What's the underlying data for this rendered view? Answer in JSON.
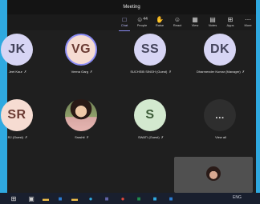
{
  "window": {
    "title": "Meeting"
  },
  "toolbar": {
    "items": [
      {
        "label": "Chat",
        "icon": "chat-icon",
        "active": true
      },
      {
        "label": "People",
        "icon": "people-icon",
        "count": "44"
      },
      {
        "label": "Raise",
        "icon": "raise-hand-icon"
      },
      {
        "label": "React",
        "icon": "react-icon"
      },
      {
        "label": "View",
        "icon": "view-icon"
      },
      {
        "label": "Notes",
        "icon": "notes-icon"
      },
      {
        "label": "Apps",
        "icon": "apps-icon"
      },
      {
        "label": "More",
        "icon": "more-icon"
      }
    ]
  },
  "participants": [
    {
      "initials": "JK",
      "name": "Jeet Kaur",
      "style": "purple"
    },
    {
      "initials": "VG",
      "name": "Veena Garg",
      "style": "peach"
    },
    {
      "initials": "SS",
      "name": "SUCHSIB SINGH (Guest)",
      "style": "purple"
    },
    {
      "initials": "DK",
      "name": "Dharmender Kumar (Manager)",
      "style": "purple"
    },
    {
      "initials": "SR",
      "name": "RJ (Guest)",
      "style": "peach"
    },
    {
      "initials": "",
      "name": "Srashti",
      "style": "photo"
    },
    {
      "initials": "S",
      "name": "SWATI (Guest)",
      "style": "green"
    },
    {
      "initials": "...",
      "name": "View all",
      "style": "dark"
    }
  ],
  "taskbar": {
    "apps": [
      {
        "icon": "windows-start-icon",
        "glyph": "⊞",
        "color": "#e6e6e6"
      },
      {
        "icon": "task-view-icon",
        "glyph": "▣",
        "color": "#d0d0d0"
      },
      {
        "icon": "file-explorer-icon",
        "glyph": "▬",
        "color": "#f2c04a"
      },
      {
        "icon": "outlook-icon",
        "glyph": "■",
        "color": "#2b7cd3"
      },
      {
        "icon": "folder-icon",
        "glyph": "▬",
        "color": "#f2c04a"
      },
      {
        "icon": "edge-icon",
        "glyph": "●",
        "color": "#2fa9e0"
      },
      {
        "icon": "teams-icon",
        "glyph": "■",
        "color": "#6264a7"
      },
      {
        "icon": "chrome-icon",
        "glyph": "●",
        "color": "#e0483c"
      },
      {
        "icon": "excel-icon",
        "glyph": "■",
        "color": "#1f8a4c"
      },
      {
        "icon": "store-icon",
        "glyph": "■",
        "color": "#2fa9e0"
      },
      {
        "icon": "word-icon",
        "glyph": "■",
        "color": "#2b7cd3"
      }
    ],
    "tray_text": "ENG"
  },
  "colors": {
    "accent": "#8b8cf5",
    "window_frame": "#2fa9e0",
    "background": "#1f1f1f"
  }
}
